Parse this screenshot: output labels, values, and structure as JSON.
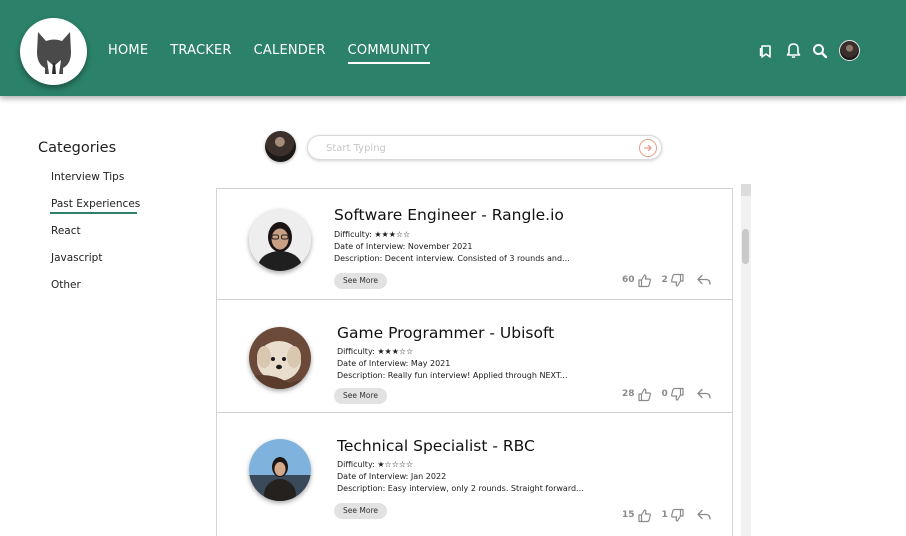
{
  "nav": {
    "items": [
      {
        "label": "HOME",
        "active": false
      },
      {
        "label": "TRACKER",
        "active": false
      },
      {
        "label": "CALENDER",
        "active": false
      },
      {
        "label": "COMMUNITY",
        "active": true
      }
    ]
  },
  "header_icons": [
    "bookmark-icon",
    "bell-icon",
    "search-icon",
    "profile-avatar"
  ],
  "sidebar": {
    "title": "Categories",
    "items": [
      {
        "label": "Interview Tips",
        "active": false
      },
      {
        "label": "Past Experiences",
        "active": true
      },
      {
        "label": "React",
        "active": false
      },
      {
        "label": "Javascript",
        "active": false
      },
      {
        "label": "Other",
        "active": false
      }
    ]
  },
  "composer": {
    "placeholder": "Start Typing"
  },
  "posts": [
    {
      "title": "Software Engineer - Rangle.io",
      "difficulty_label": "Difficulty:",
      "difficulty_stars": "★★★☆☆",
      "date": "Date of Interview: November 2021",
      "description": "Description: Decent interview. Consisted of 3 rounds and...",
      "see_more": "See More",
      "likes": "60",
      "dislikes": "2"
    },
    {
      "title": "Game Programmer - Ubisoft",
      "difficulty_label": "Difficulty:",
      "difficulty_stars": "★★★☆☆",
      "date": "Date of Interview: May 2021",
      "description": "Description: Really fun interview! Applied through NEXT...",
      "see_more": "See More",
      "likes": "28",
      "dislikes": "0"
    },
    {
      "title": "Technical Specialist - RBC",
      "difficulty_label": "Difficulty:",
      "difficulty_stars": "★☆☆☆☆",
      "date": "Date of Interview: Jan 2022",
      "description": "Description: Easy interview, only 2 rounds. Straight forward...",
      "see_more": "See More",
      "likes": "15",
      "dislikes": "1"
    }
  ],
  "colors": {
    "brand": "#2b8169",
    "accent_send": "#e8a08a"
  }
}
